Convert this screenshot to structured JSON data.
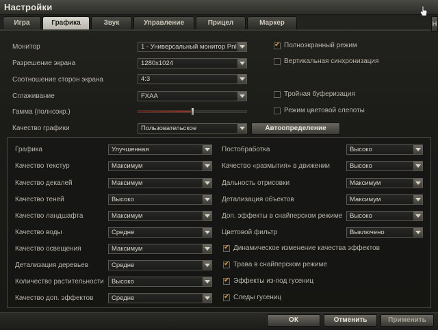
{
  "window": {
    "title": "Настройки"
  },
  "tabs": [
    "Игра",
    "Графика",
    "Звук",
    "Управление",
    "Прицел",
    "Маркер"
  ],
  "top": {
    "monitor_label": "Монитор",
    "monitor_value": "1 - Универсальный монитор PnI",
    "resolution_label": "Разрешение экрана",
    "resolution_value": "1280x1024",
    "aspect_label": "Соотношение сторон экрана",
    "aspect_value": "4:3",
    "aa_label": "Сглаживание",
    "aa_value": "FXAA",
    "gamma_label": "Гамма (полноэкр.)",
    "gamma_level": 0.5,
    "quality_label": "Качество графики",
    "quality_value": "Пользовательское",
    "autodetect_label": "Автоопределение",
    "fullscreen_label": "Полноэкранный режим",
    "fullscreen_checked": true,
    "vsync_label": "Вертикальная синхронизация",
    "vsync_checked": false,
    "triple_label": "Тройная буферизация",
    "triple_checked": false,
    "colorblind_label": "Режим цветовой слепоты",
    "colorblind_checked": false
  },
  "left_settings": [
    {
      "label": "Графика",
      "value": "Улучшенная"
    },
    {
      "label": "Качество текстур",
      "value": "Максимум"
    },
    {
      "label": "Качество декалей",
      "value": "Максимум"
    },
    {
      "label": "Качество теней",
      "value": "Высоко"
    },
    {
      "label": "Качество ландшафта",
      "value": "Максимум"
    },
    {
      "label": "Качество воды",
      "value": "Средне"
    },
    {
      "label": "Качество освещения",
      "value": "Максимум"
    },
    {
      "label": "Детализация деревьев",
      "value": "Средне"
    },
    {
      "label": "Количество растительности",
      "value": "Высоко"
    },
    {
      "label": "Качество доп. эффектов",
      "value": "Средне"
    }
  ],
  "right_settings": [
    {
      "label": "Постобработка",
      "value": "Высоко"
    },
    {
      "label": "Качество «размытия» в движении",
      "value": "Высоко"
    },
    {
      "label": "Дальность отрисовки",
      "value": "Максимум"
    },
    {
      "label": "Детализация объектов",
      "value": "Максимум"
    },
    {
      "label": "Доп. эффекты в снайперском режиме",
      "value": "Высоко"
    },
    {
      "label": "Цветовой фильтр",
      "value": "Выключено"
    }
  ],
  "right_checks": [
    {
      "label": "Динамическое изменение качества эффектов",
      "checked": true
    },
    {
      "label": "Трава в снайперском режиме",
      "checked": true
    },
    {
      "label": "Эффекты из-под гусениц",
      "checked": true
    },
    {
      "label": "Следы гусениц",
      "checked": true
    }
  ],
  "buttons": {
    "ok": "ОК",
    "cancel": "Отменить",
    "apply": "Применить"
  },
  "side_button": "Н"
}
